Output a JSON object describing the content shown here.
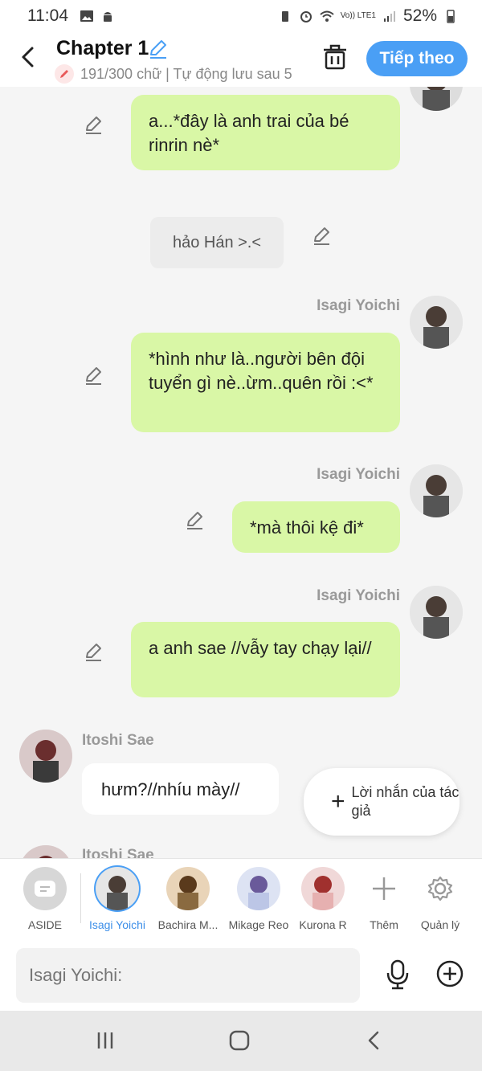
{
  "status": {
    "time": "11:04",
    "battery": "52%",
    "network": "Vo)) LTE1"
  },
  "header": {
    "title": "Chapter 1",
    "subtitle": "191/300 chữ | Tự động lưu sau 5",
    "next_label": "Tiếp theo"
  },
  "messages": [
    {
      "side": "right",
      "text": "a...*đây là anh trai của bé rinrin nè*"
    },
    {
      "side": "aside",
      "text": "hảo Hán >.<"
    },
    {
      "side": "right",
      "name": "Isagi Yoichi",
      "text": "*hình như là..người bên đội tuyển gì nè..ừm..quên rồi :<*"
    },
    {
      "side": "right",
      "name": "Isagi Yoichi",
      "text": "*mà thôi kệ đi*"
    },
    {
      "side": "right",
      "name": "Isagi Yoichi",
      "text": "a anh sae //vẫy tay chạy lại//"
    },
    {
      "side": "left",
      "name": "Itoshi Sae",
      "text": "hưm?//nhíu mày//"
    },
    {
      "side": "left",
      "name": "Itoshi Sae",
      "text": ""
    }
  ],
  "author_note": {
    "label": "Lời nhắn của tác giả"
  },
  "characters": [
    {
      "label": "ASIDE"
    },
    {
      "label": "Isagi Yoichi",
      "active": true
    },
    {
      "label": "Bachira M..."
    },
    {
      "label": "Mikage Reo"
    },
    {
      "label": "Kurona R"
    },
    {
      "label": "Thêm"
    },
    {
      "label": "Quản lý"
    }
  ],
  "input": {
    "placeholder": "Isagi Yoichi:"
  },
  "colors": {
    "accent": "#4a9ff5",
    "bubble_right": "#d9f7a6",
    "bubble_left": "#ffffff"
  }
}
